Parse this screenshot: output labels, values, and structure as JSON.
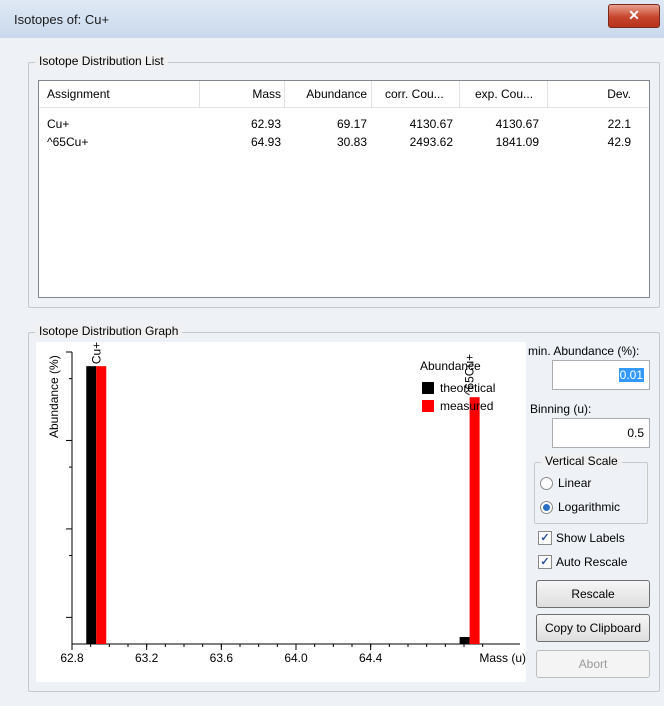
{
  "window": {
    "title": "Isotopes of: Cu+",
    "close_glyph": "✕"
  },
  "list_group": {
    "label": "Isotope Distribution List",
    "columns": [
      "Assignment",
      "Mass",
      "Abundance",
      "corr. Cou...",
      "exp. Cou...",
      "Dev."
    ],
    "rows": [
      [
        "Cu+",
        "62.93",
        "69.17",
        "4130.67",
        "4130.67",
        "22.1"
      ],
      [
        "^65Cu+",
        "64.93",
        "30.83",
        "2493.62",
        "1841.09",
        "42.9"
      ]
    ]
  },
  "graph_group": {
    "label": "Isotope Distribution Graph"
  },
  "chart_data": {
    "type": "bar",
    "title": "",
    "xlabel": "Mass (u)",
    "ylabel": "Abundance (%)",
    "y_scale": "log",
    "xlim": [
      62.8,
      65.2
    ],
    "x_ticks": [
      "62.8",
      "63.2",
      "63.6",
      "64.0",
      "64.4"
    ],
    "legend": {
      "title": "Abundance",
      "position": "top-right"
    },
    "peak_labels": [
      "Cu+",
      "^65Cu+"
    ],
    "x": [
      62.93,
      64.93
    ],
    "series": [
      {
        "name": "theoretical",
        "color": "#000000",
        "values": [
          69.17,
          0.06
        ]
      },
      {
        "name": "measured",
        "color": "#ff0000",
        "values": [
          69.17,
          30.83
        ]
      }
    ]
  },
  "controls": {
    "min_abundance_label": "min. Abundance (%):",
    "min_abundance_value": "0.01",
    "binning_label": "Binning (u):",
    "binning_value": "0.5",
    "vertical_scale_label": "Vertical Scale",
    "linear_label": "Linear",
    "logarithmic_label": "Logarithmic",
    "vertical_scale_selected": "Logarithmic",
    "show_labels_label": "Show Labels",
    "show_labels_checked": true,
    "auto_rescale_label": "Auto Rescale",
    "auto_rescale_checked": true,
    "rescale_label": "Rescale",
    "copy_label": "Copy to Clipboard",
    "abort_label": "Abort",
    "check_glyph": "✓"
  }
}
